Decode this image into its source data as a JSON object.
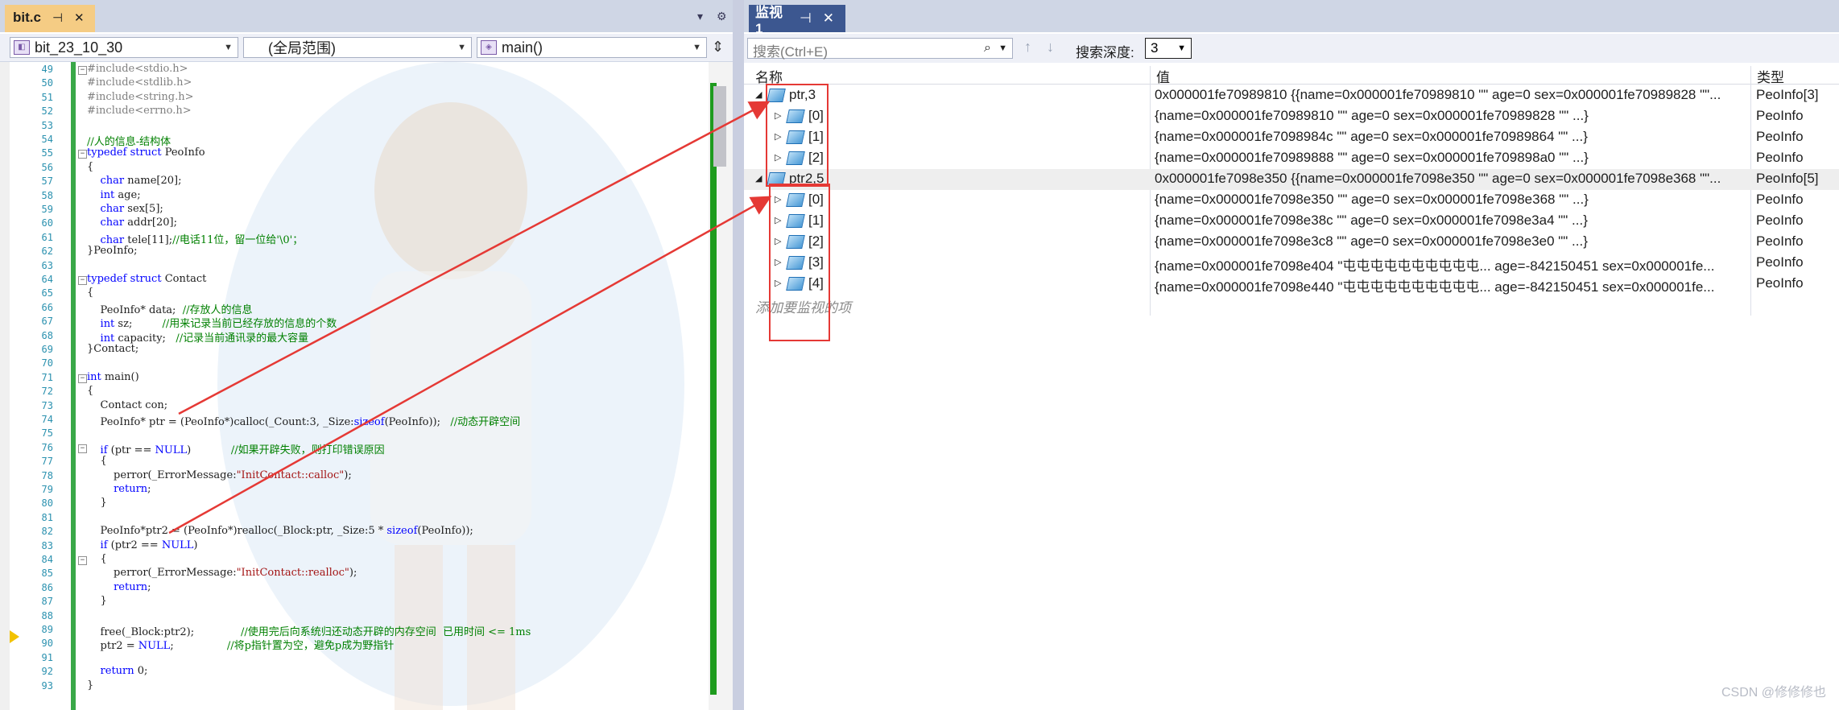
{
  "editor": {
    "tab": {
      "title": "bit.c",
      "pin": "⊣",
      "close": "✕"
    },
    "tab_controls": {
      "dropdown": "▾",
      "gear": "⚙"
    },
    "nav": {
      "project": "bit_23_10_30",
      "scope": "(全局范围)",
      "function": "main()"
    },
    "lines": [
      {
        "n": "49",
        "text": "#include<stdio.h>"
      },
      {
        "n": "50",
        "text": "#include<stdlib.h>"
      },
      {
        "n": "51",
        "text": "#include<string.h>"
      },
      {
        "n": "52",
        "text": "#include<errno.h>"
      },
      {
        "n": "53",
        "text": ""
      },
      {
        "n": "54",
        "text": "//人的信息-结构体"
      },
      {
        "n": "55",
        "text": "typedef struct PeoInfo"
      },
      {
        "n": "56",
        "text": "{"
      },
      {
        "n": "57",
        "text": "    char name[20];"
      },
      {
        "n": "58",
        "text": "    int age;"
      },
      {
        "n": "59",
        "text": "    char sex[5];"
      },
      {
        "n": "60",
        "text": "    char addr[20];"
      },
      {
        "n": "61",
        "text": "    char tele[11];//电话11位，留一位给'\\0'；"
      },
      {
        "n": "62",
        "text": "}PeoInfo;"
      },
      {
        "n": "63",
        "text": ""
      },
      {
        "n": "64",
        "text": "typedef struct Contact"
      },
      {
        "n": "65",
        "text": "{"
      },
      {
        "n": "66",
        "text": "    PeoInfo* data;  //存放人的信息"
      },
      {
        "n": "67",
        "text": "    int sz;         //用来记录当前已经存放的信息的个数"
      },
      {
        "n": "68",
        "text": "    int capacity;   //记录当前通讯录的最大容量"
      },
      {
        "n": "69",
        "text": "}Contact;"
      },
      {
        "n": "70",
        "text": ""
      },
      {
        "n": "71",
        "text": "int main()"
      },
      {
        "n": "72",
        "text": "{"
      },
      {
        "n": "73",
        "text": "    Contact con;"
      },
      {
        "n": "74",
        "text": "    PeoInfo* ptr = (PeoInfo*)calloc(_Count:3, _Size:sizeof(PeoInfo));   //动态开辟空间"
      },
      {
        "n": "75",
        "text": ""
      },
      {
        "n": "76",
        "text": "    if (ptr == NULL)            //如果开辟失败，则打印错误原因"
      },
      {
        "n": "77",
        "text": "    {"
      },
      {
        "n": "78",
        "text": "        perror(_ErrorMessage:\"InitContact::calloc\");"
      },
      {
        "n": "79",
        "text": "        return;"
      },
      {
        "n": "80",
        "text": "    }"
      },
      {
        "n": "81",
        "text": ""
      },
      {
        "n": "82",
        "text": "    PeoInfo*ptr2 = (PeoInfo*)realloc(_Block:ptr, _Size:5 * sizeof(PeoInfo));"
      },
      {
        "n": "83",
        "text": "    if (ptr2 == NULL)"
      },
      {
        "n": "84",
        "text": "    {"
      },
      {
        "n": "85",
        "text": "        perror(_ErrorMessage:\"InitContact::realloc\");"
      },
      {
        "n": "86",
        "text": "        return;"
      },
      {
        "n": "87",
        "text": "    }"
      },
      {
        "n": "88",
        "text": ""
      },
      {
        "n": "89",
        "text": "    free(_Block:ptr2);              //使用完后向系统归还动态开辟的内存空间  已用时间 <= 1ms"
      },
      {
        "n": "90",
        "text": "    ptr2 = NULL;                //将p指针置为空，避免p成为野指针"
      },
      {
        "n": "91",
        "text": ""
      },
      {
        "n": "92",
        "text": "    return 0;"
      },
      {
        "n": "93",
        "text": "}"
      }
    ]
  },
  "watch": {
    "tab": {
      "title": "监视 1",
      "pin": "⊣",
      "close": "✕"
    },
    "search_placeholder": "搜索(Ctrl+E)",
    "search_icon": "search-icon",
    "depth_label": "搜索深度:",
    "depth_value": "3",
    "columns": {
      "name": "名称",
      "value": "值",
      "type": "类型"
    },
    "rows": [
      {
        "level": 0,
        "expanded": true,
        "name": "ptr,3",
        "value": "0x000001fe70989810 {{name=0x000001fe70989810 \"\" age=0 sex=0x000001fe70989828 \"\"...",
        "type": "PeoInfo[3]"
      },
      {
        "level": 1,
        "expanded": false,
        "name": "[0]",
        "value": "{name=0x000001fe70989810 \"\" age=0 sex=0x000001fe70989828 \"\" ...}",
        "type": "PeoInfo"
      },
      {
        "level": 1,
        "expanded": false,
        "name": "[1]",
        "value": "{name=0x000001fe7098984c \"\" age=0 sex=0x000001fe70989864 \"\" ...}",
        "type": "PeoInfo"
      },
      {
        "level": 1,
        "expanded": false,
        "name": "[2]",
        "value": "{name=0x000001fe70989888 \"\" age=0 sex=0x000001fe709898a0 \"\" ...}",
        "type": "PeoInfo"
      },
      {
        "level": 0,
        "expanded": true,
        "name": "ptr2,5",
        "value": "0x000001fe7098e350 {{name=0x000001fe7098e350 \"\" age=0 sex=0x000001fe7098e368 \"\"...",
        "type": "PeoInfo[5]"
      },
      {
        "level": 1,
        "expanded": false,
        "name": "[0]",
        "value": "{name=0x000001fe7098e350 \"\" age=0 sex=0x000001fe7098e368 \"\" ...}",
        "type": "PeoInfo"
      },
      {
        "level": 1,
        "expanded": false,
        "name": "[1]",
        "value": "{name=0x000001fe7098e38c \"\" age=0 sex=0x000001fe7098e3a4 \"\" ...}",
        "type": "PeoInfo"
      },
      {
        "level": 1,
        "expanded": false,
        "name": "[2]",
        "value": "{name=0x000001fe7098e3c8 \"\" age=0 sex=0x000001fe7098e3e0 \"\" ...}",
        "type": "PeoInfo"
      },
      {
        "level": 1,
        "expanded": false,
        "name": "[3]",
        "value": "{name=0x000001fe7098e404 \"屯屯屯屯屯屯屯屯屯屯... age=-842150451 sex=0x000001fe...",
        "type": "PeoInfo"
      },
      {
        "level": 1,
        "expanded": false,
        "name": "[4]",
        "value": "{name=0x000001fe7098e440 \"屯屯屯屯屯屯屯屯屯屯... age=-842150451 sex=0x000001fe...",
        "type": "PeoInfo"
      }
    ],
    "add_item": "添加要监视的项"
  },
  "watermark": "CSDN @修修修也",
  "colors": {
    "accent_tab": "#3c5790",
    "file_tab": "#f5cc84",
    "annotation_red": "#e53935",
    "change_bar": "#39a848"
  }
}
